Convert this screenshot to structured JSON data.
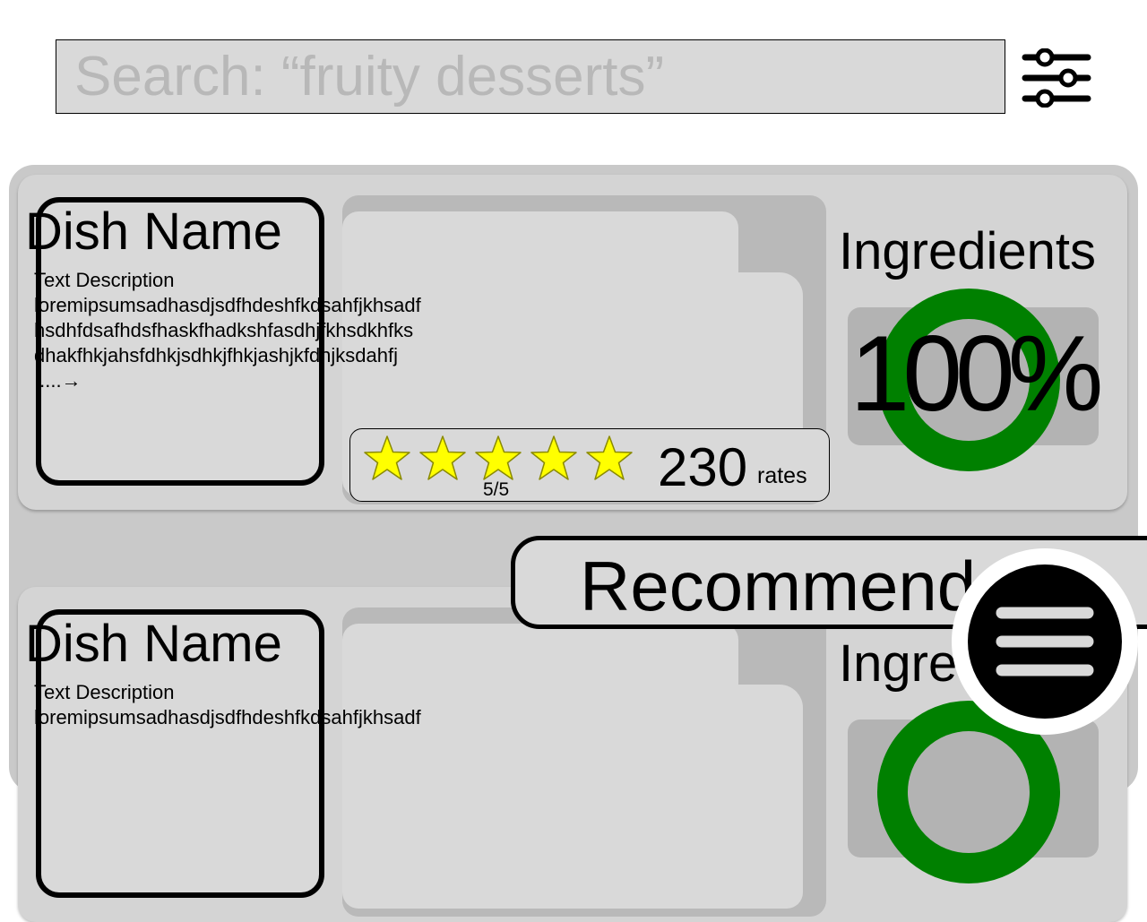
{
  "search": {
    "placeholder": "Search: “fruity desserts”"
  },
  "filter": {
    "icon": "sliders-icon"
  },
  "cards": [
    {
      "dish_name": "Dish Name",
      "description_label": "Text Description",
      "description_lines": [
        "loremipsumsadhasdjsdfhdeshfkdsahfjkhsadf",
        "hsdhfdsafhdsfhaskfhadkshfasdhjfkhsdkhfks",
        "dhakfhkjahsfdhkjsdhkjfhkjashjkfdhjksdahfj"
      ],
      "more_link": ".....→",
      "stars": 5,
      "rating": "5/5",
      "rate_count": "230",
      "rate_label": "rates",
      "ingredients_title": "Ingredients",
      "ingredients_match": "100%"
    },
    {
      "dish_name": "Dish Name",
      "description_label": "Text Description",
      "description_lines": [
        "loremipsumsadhasdjsdfhdeshfkdsahfjkhsadf"
      ],
      "ingredients_title": "Ingredients"
    }
  ],
  "recommend": {
    "label": "Recommended"
  },
  "menu": {
    "icon": "hamburger-menu-icon"
  },
  "colors": {
    "star_fill": "#ffff00",
    "ring_green": "#008000",
    "panel_gray": "#c9c9c9"
  }
}
